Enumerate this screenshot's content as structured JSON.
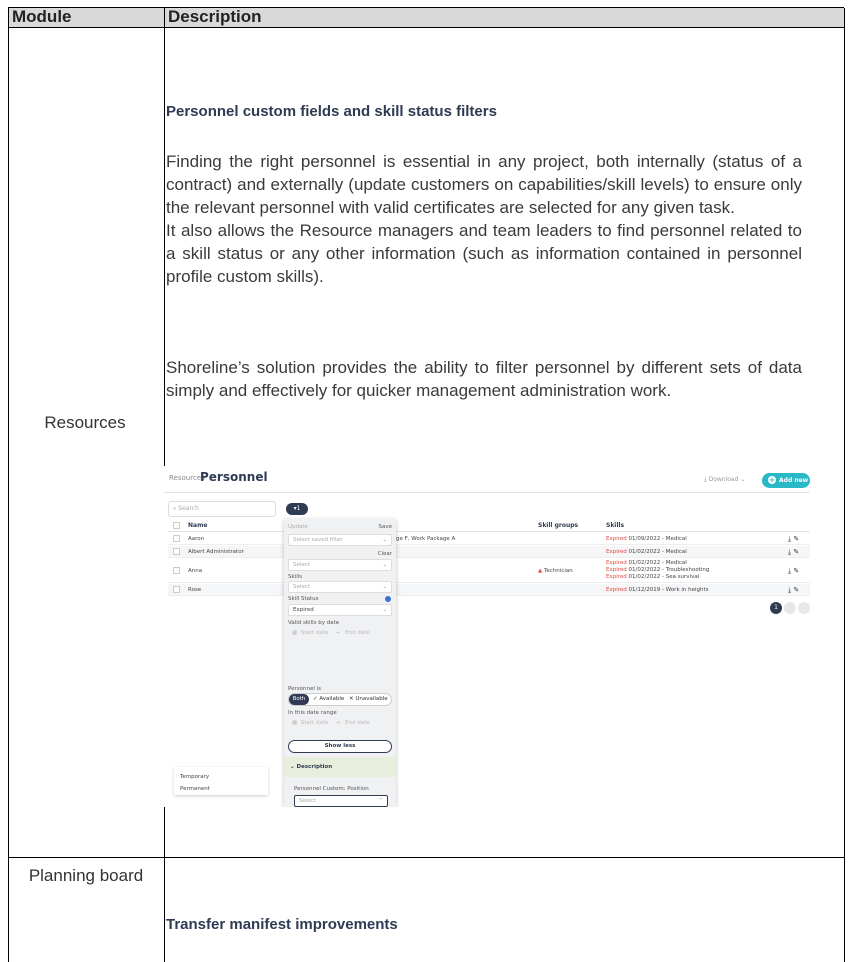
{
  "table": {
    "headers": {
      "module": "Module",
      "description": "Description"
    }
  },
  "rows": [
    {
      "module": "Resources",
      "section_title": "Personnel custom fields and skill status filters",
      "paragraph_1": "Finding the right personnel is essential in any project, both internally (status of a contract) and externally (update customers on capabilities/skill levels) to ensure only the relevant personnel with valid certificates are selected for any given task.",
      "paragraph_2": "It also allows the Resource managers and team leaders to find personnel related to a skill status or any other information (such as information contained in personnel profile custom skills).",
      "paragraph_3": "Shoreline’s solution provides the ability to filter personnel by different sets of data simply and effectively for quicker management administration work."
    },
    {
      "module": "Planning board",
      "section_title": "Transfer manifest improvements"
    }
  ],
  "screenshot": {
    "breadcrumb": "Resources",
    "page_title": "Personnel",
    "download_label": "Download",
    "add_new_label": "Add new",
    "search_placeholder": "Search",
    "filter_count": "1",
    "columns": [
      "Name",
      "Skill groups",
      "Skills"
    ],
    "people": [
      {
        "name": "Aaron",
        "packages": "ge F, Work Package A",
        "skill_group": "",
        "skills": [
          [
            "Expired",
            "01/09/2022 - Medical"
          ]
        ]
      },
      {
        "name": "Albert Administrator",
        "packages": "",
        "skill_group": "",
        "skills": [
          [
            "Expired",
            "01/02/2022 - Medical"
          ]
        ]
      },
      {
        "name": "Anna",
        "packages": "",
        "skill_group": "Technician",
        "skills": [
          [
            "Expired",
            "01/02/2022 - Medical"
          ],
          [
            "Expired",
            "01/02/2022 - Troubleshooting"
          ],
          [
            "Expired",
            "01/02/2022 - Sea survival"
          ]
        ]
      },
      {
        "name": "Rose",
        "packages": "",
        "skill_group": "",
        "skills": [
          [
            "Expired",
            "01/12/2019 - Work in heights"
          ]
        ]
      }
    ],
    "pagination_current": "1",
    "filter_panel": {
      "update_label": "Update",
      "save_label": "Save",
      "saved_filter_placeholder": "Select saved filter",
      "clear_label": "Clear",
      "select_placeholder": "Select",
      "skills_label": "Skills",
      "skills_placeholder": "Select",
      "skill_status_label": "Skill Status",
      "skill_status_value": "Expired",
      "valid_skills_label": "Valid skills by date",
      "start_date": "Start date",
      "end_date": "End date",
      "personnel_is_label": "Personnel is",
      "both_label": "Both",
      "available_label": "✓ Available",
      "unavailable_label": "✕ Unavailable",
      "date_range_label": "In this date range",
      "show_less_label": "Show less",
      "description_label": "Description",
      "custom_position_label": "Personnel Custom: Position",
      "position_placeholder": "Select",
      "options": [
        "Temporary",
        "Permanent"
      ]
    },
    "colors": {
      "accent": "#28b8c6",
      "navy": "#2f3b52",
      "expired": "#e04a3f"
    }
  }
}
